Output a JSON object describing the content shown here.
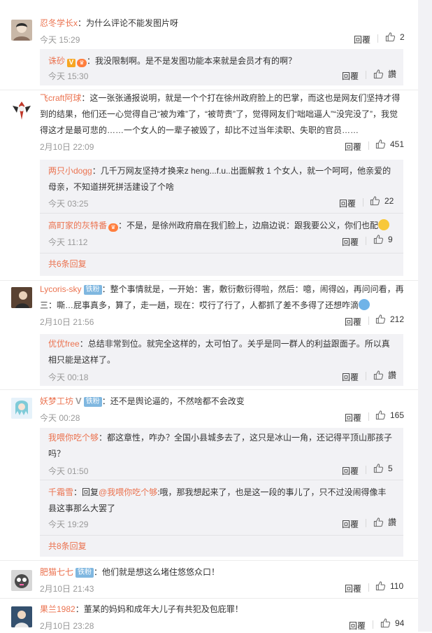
{
  "common": {
    "reply_label": "回覆"
  },
  "comments": [
    {
      "user": "忍冬学长x",
      "text": "：为什么评论不能发图片呀",
      "time": "今天 15:29",
      "likes": "2",
      "replies": [
        {
          "user": "诛砂",
          "text": "：我没限制啊。是不是发图功能本来就是会员才有的啊？",
          "time": "今天 15:30",
          "likes": "讚"
        }
      ]
    },
    {
      "user": "飞craft阿球",
      "text": "：这一张张通报说明，就是一个个打在徐州政府脸上的巴掌，而这也是网友们坚持才得到的结果，他们还一心觉得自己“被为难”了，“被苛责”了，觉得网友们“咄咄逼人”“没完没了”，我觉得这才是最可悲的……一个女人的一辈子被毁了，却比不过当年渎职、失职的官员……",
      "time": "2月10日 22:09",
      "likes": "451",
      "replies": [
        {
          "user": "两只小dogg",
          "text": "：几千万网友坚持才换来z heng...f.u..出面解救 1 个女人，就一个呵呵，他亲爱的母亲，不知道拼死拼活建设了个啥",
          "time": "今天 03:25",
          "likes": "22"
        },
        {
          "user": "高町家的灰特番",
          "text": "：不是，是徐州政府扇在我们脸上，边扇边说：跟我要公义，你们也配",
          "time": "今天 11:12",
          "likes": "9"
        }
      ],
      "more": "共6条回复"
    },
    {
      "user": "Lycoris-sky",
      "fan_badge": "铁粉",
      "text": "：整个事情就是，一开始：害，敷衍敷衍得啦，然后：噫，闹得凶，再问问看，再三：嘶…屁事真多，算了，走一趟，现在：哎行了行了，人都抓了差不多得了还想咋滴",
      "time": "2月10日 21:56",
      "likes": "212",
      "replies": [
        {
          "user": "优优free",
          "text": "：总结非常到位。就完全这样的，太可怕了。关乎是同一群人的利益跟面子。所以真相只能是这样了。",
          "time": "今天 00:18",
          "likes": "讚"
        }
      ]
    },
    {
      "user": "妖梦工坊",
      "fan_badge": "铁粉",
      "text": "：还不是舆论逼的，不然啥都不会改变",
      "time": "今天 00:28",
      "likes": "165",
      "replies": [
        {
          "user": "我喂你吃个够",
          "text": "：都这章性，咋办？全国小县城多去了，这只是冰山一角，还记得平顶山那孩子吗？",
          "time": "今天 01:50",
          "likes": "5"
        },
        {
          "user": "千霜雪",
          "text_prefix": "：回复",
          "mention": "@我喂你吃个够",
          "text": ":哦，那我想起来了，也是这一段的事儿了，只不过没闹得像丰县这事那么大罢了",
          "time": "今天 19:29",
          "likes": "讚"
        }
      ],
      "more": "共8条回复"
    },
    {
      "user": "肥猫七七",
      "fan_badge": "铁粉",
      "text": "：他们就是想这么堵住悠悠众口！",
      "time": "2月10日 21:43",
      "likes": "110"
    },
    {
      "user": "果兰1982",
      "text": "：董某的妈妈和成年大儿子有共犯及包庇罪！",
      "time": "2月10日 23:28",
      "likes": "94"
    }
  ]
}
